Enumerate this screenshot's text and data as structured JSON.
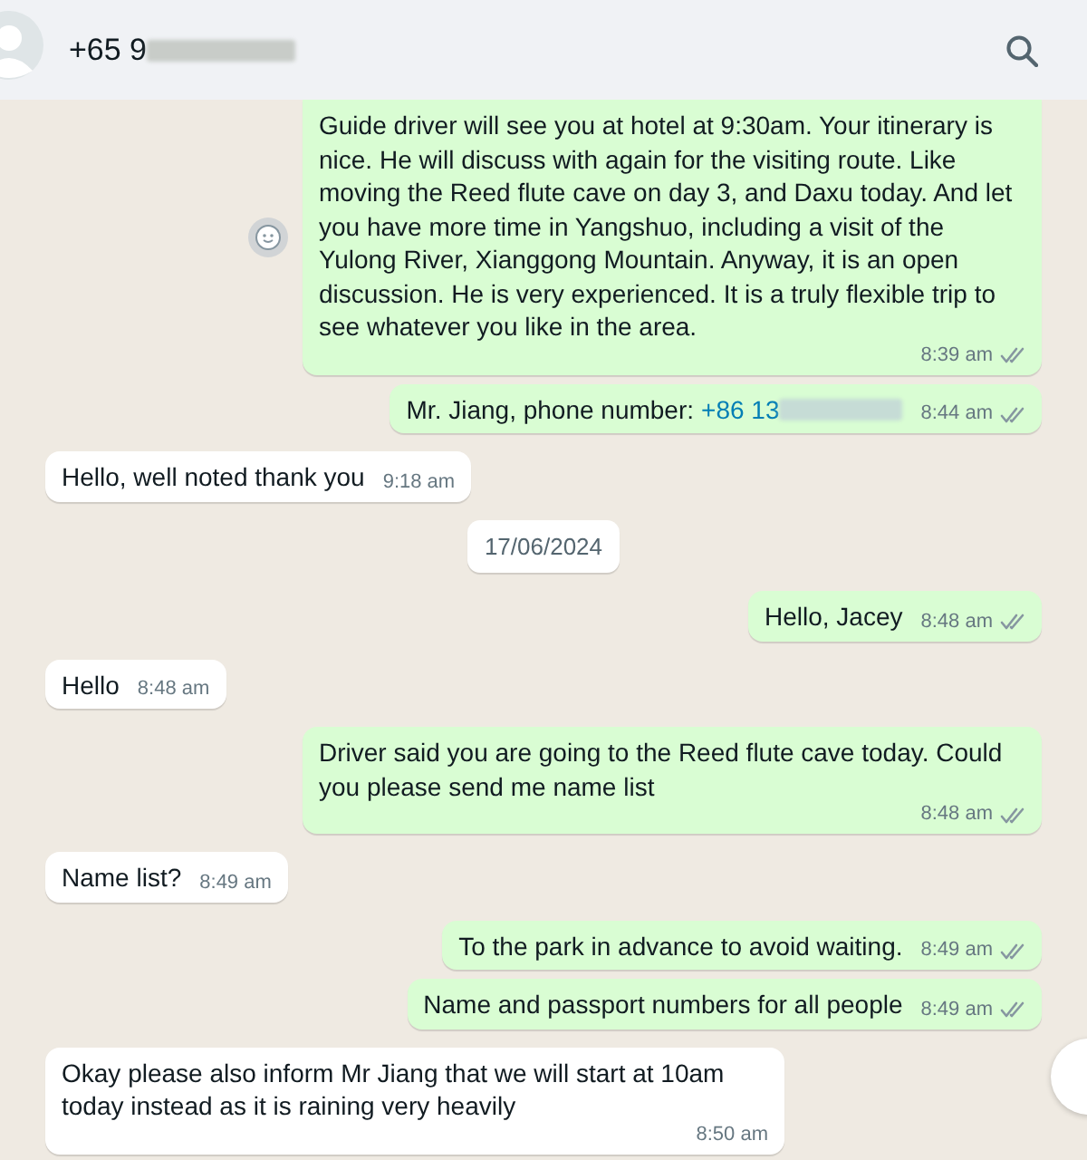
{
  "header": {
    "title": "+65 9",
    "redacted": true
  },
  "messages": [
    {
      "kind": "out",
      "text": "Guide driver will see you at hotel at 9:30am. Your itinerary is nice. He will discuss with again for the visiting route. Like moving the Reed flute cave on day 3, and Daxu today. And let you have more time in Yangshuo, including a visit of the Yulong River, Xianggong Mountain. Anyway, it is an open discussion. He is very experienced. It is a truly flexible trip to see whatever you like in the area.",
      "time": "8:39 am",
      "reaction_button": true
    },
    {
      "kind": "out",
      "text": "Mr. Jiang, phone number:",
      "link": "+86 13",
      "link_redacted": true,
      "time": "8:44 am"
    },
    {
      "kind": "in",
      "text": "Hello, well noted thank you",
      "time": "9:18 am"
    },
    {
      "kind": "date",
      "text": "17/06/2024"
    },
    {
      "kind": "out",
      "text": "Hello, Jacey",
      "time": "8:48 am"
    },
    {
      "kind": "in",
      "text": "Hello",
      "time": "8:48 am"
    },
    {
      "kind": "out",
      "text": "Driver said you are going to the Reed flute cave today. Could you please send me name list",
      "time": "8:48 am"
    },
    {
      "kind": "in",
      "text": "Name list?",
      "time": "8:49 am"
    },
    {
      "kind": "out",
      "text": "To the park in advance to avoid waiting.",
      "time": "8:49 am"
    },
    {
      "kind": "out",
      "text": "Name and passport numbers for all people",
      "time": "8:49 am"
    },
    {
      "kind": "in",
      "text": "Okay please also inform Mr Jiang that we will start at 10am today instead as it is raining very heavily",
      "time": "8:50 am"
    }
  ]
}
